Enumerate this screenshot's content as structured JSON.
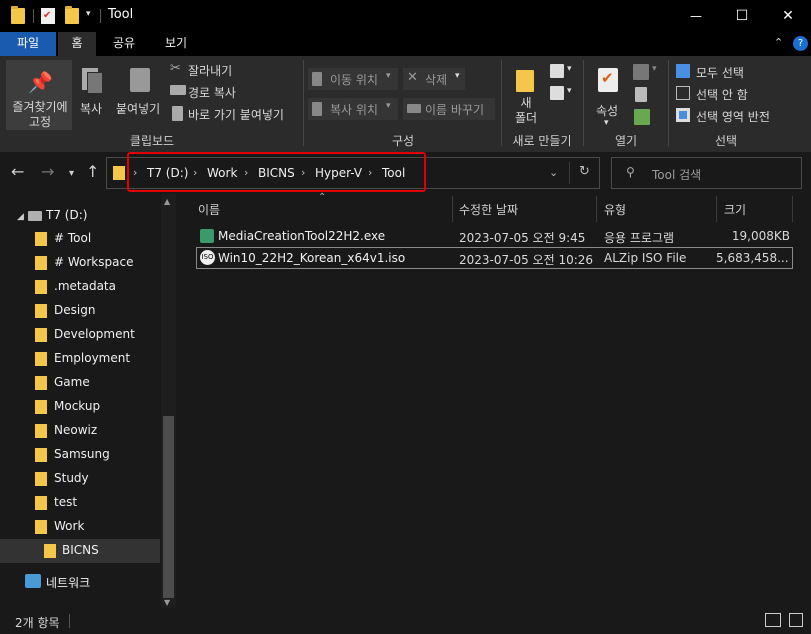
{
  "window": {
    "title": "Tool",
    "minimize_glyph": "—",
    "maximize_glyph": "☐",
    "close_glyph": "✕"
  },
  "ribbon_tabs": {
    "file": "파일",
    "home": "홈",
    "share": "공유",
    "view": "보기"
  },
  "ribbon": {
    "clipboard": {
      "pin": "즐겨찾기에\n고정",
      "copy": "복사",
      "paste": "붙여넣기",
      "cut": "잘라내기",
      "copy_path": "경로 복사",
      "paste_shortcut": "바로 가기 붙여넣기",
      "group_label": "클립보드"
    },
    "organize": {
      "move_to": "이동 위치",
      "copy_to": "복사 위치",
      "delete": "삭제",
      "rename": "이름 바꾸기",
      "group_label": "구성"
    },
    "new": {
      "new_folder": "새\n폴더",
      "group_label": "새로 만들기"
    },
    "open": {
      "properties": "속성",
      "group_label": "열기"
    },
    "select": {
      "select_all": "모두 선택",
      "select_none": "선택 안 함",
      "invert": "선택 영역 반전",
      "group_label": "선택"
    }
  },
  "address": {
    "crumbs": [
      "T7 (D:)",
      "Work",
      "BICNS",
      "Hyper-V",
      "Tool"
    ],
    "search_placeholder": "Tool 검색"
  },
  "nav": {
    "drive": "T7 (D:)",
    "items": [
      "# Tool",
      "# Workspace",
      ".metadata",
      "Design",
      "Development",
      "Employment",
      "Game",
      "Mockup",
      "Neowiz",
      "Samsung",
      "Study",
      "test",
      "Work",
      "BICNS"
    ],
    "network": "네트워크"
  },
  "columns": {
    "name": "이름",
    "date": "수정한 날짜",
    "type": "유형",
    "size": "크기"
  },
  "files": [
    {
      "name": "MediaCreationTool22H2.exe",
      "date": "2023-07-05 오전 9:45",
      "type": "응용 프로그램",
      "size": "19,008KB",
      "icon": "installer-icon"
    },
    {
      "name": "Win10_22H2_Korean_x64v1.iso",
      "date": "2023-07-05 오전 10:26",
      "type": "ALZip ISO File",
      "size": "5,683,458...",
      "icon": "iso-icon"
    }
  ],
  "status": {
    "item_count": "2개 항목"
  },
  "colors": {
    "accent": "#1a5bb0",
    "folder": "#f4c74a",
    "highlight": "#e00000"
  }
}
